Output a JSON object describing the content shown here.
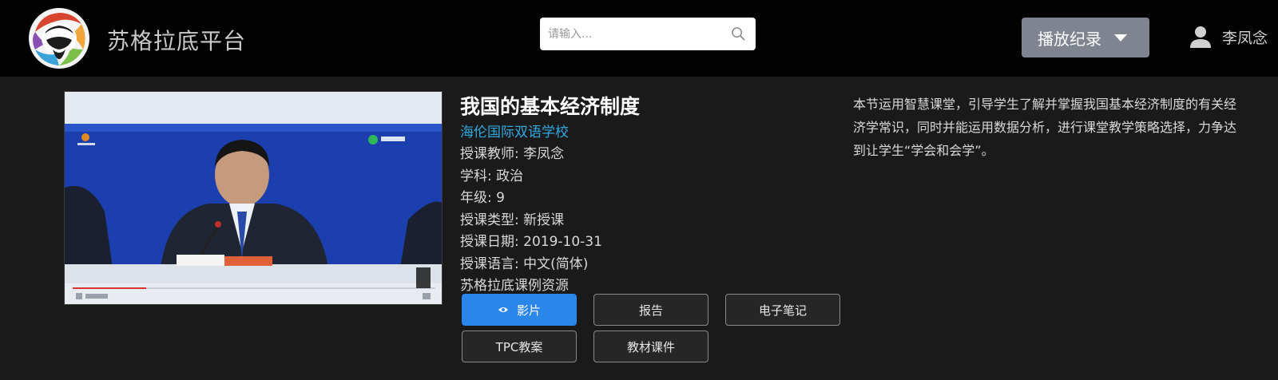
{
  "header": {
    "brand": "苏格拉底平台",
    "logo_icon": "socrates-logo-icon",
    "search": {
      "placeholder": "请输入..."
    },
    "play_record_label": "播放纪录",
    "user_name": "李凤念"
  },
  "course": {
    "title": "我国的基本经济制度",
    "school": "海伦国际双语学校",
    "teacher": "授课教师: 李凤念",
    "subject": "学科: 政治",
    "grade": "年级: 9",
    "lesson_type": "授课类型: 新授课",
    "date": "授课日期: 2019-10-31",
    "language": "授课语言: 中文(简体)",
    "resource": "苏格拉底课例资源",
    "description": "本节运用智慧课堂，引导学生了解并掌握我国基本经济制度的有关经济学常识，同时并能运用数据分析，进行课堂教学策略选择，力争达到让学生“学会和会学”。"
  },
  "buttons": {
    "video": "影片",
    "report": "报告",
    "notes": "电子笔记",
    "tpc": "TPC教案",
    "materials": "教材课件"
  },
  "colors": {
    "header_bg": "#020202",
    "page_bg": "#1a1a1a",
    "primary": "#2a86e8",
    "link": "#2fa8df",
    "dropdown_bg": "#7f8490"
  }
}
